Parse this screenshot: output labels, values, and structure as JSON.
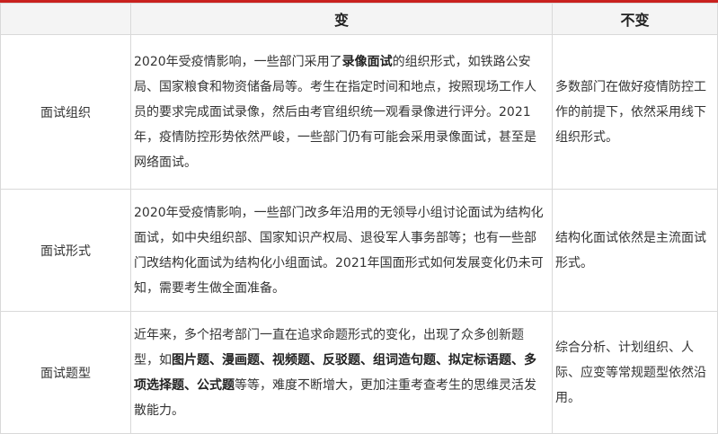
{
  "header": {
    "col_category": "",
    "col_change": "变",
    "col_unchanged": "不变"
  },
  "rows": [
    {
      "category": "面试组织",
      "change": [
        {
          "text": "2020年受疫情影响，一些部门采用了",
          "bold": false
        },
        {
          "text": "录像面试",
          "bold": true
        },
        {
          "text": "的组织形式，如铁路公安局、国家粮食和物资储备局等。考生在指定时间和地点，按照现场工作人员的要求完成面试录像，然后由考官组织统一观看录像进行评分。2021年，疫情防控形势依然严峻，一些部门仍有可能会采用录像面试，甚至是网络面试。",
          "bold": false
        }
      ],
      "unchanged": "多数部门在做好疫情防控工作的前提下，依然采用线下组织形式。"
    },
    {
      "category": "面试形式",
      "change": [
        {
          "text": "2020年受疫情影响，一些部门改多年沿用的无领导小组讨论面试为结构化面试，如中央组织部、国家知识产权局、退役军人事务部等；也有一些部门改结构化面试为结构化小组面试。2021年国面形式如何发展变化仍未可知，需要考生做全面准备。",
          "bold": false
        }
      ],
      "unchanged": "结构化面试依然是主流面试形式。"
    },
    {
      "category": "面试题型",
      "change": [
        {
          "text": "近年来，多个招考部门一直在追求命题形式的变化，出现了众多创新题型，如",
          "bold": false
        },
        {
          "text": "图片题、漫画题、视频题、反驳题、组词造句题、拟定标语题、多项选择题、公式题",
          "bold": true
        },
        {
          "text": "等等，难度不断增大，更加注重考查考生的思维灵活发散能力。",
          "bold": false
        }
      ],
      "unchanged": "综合分析、计划组织、人际、应变等常规题型依然沿用。"
    }
  ]
}
